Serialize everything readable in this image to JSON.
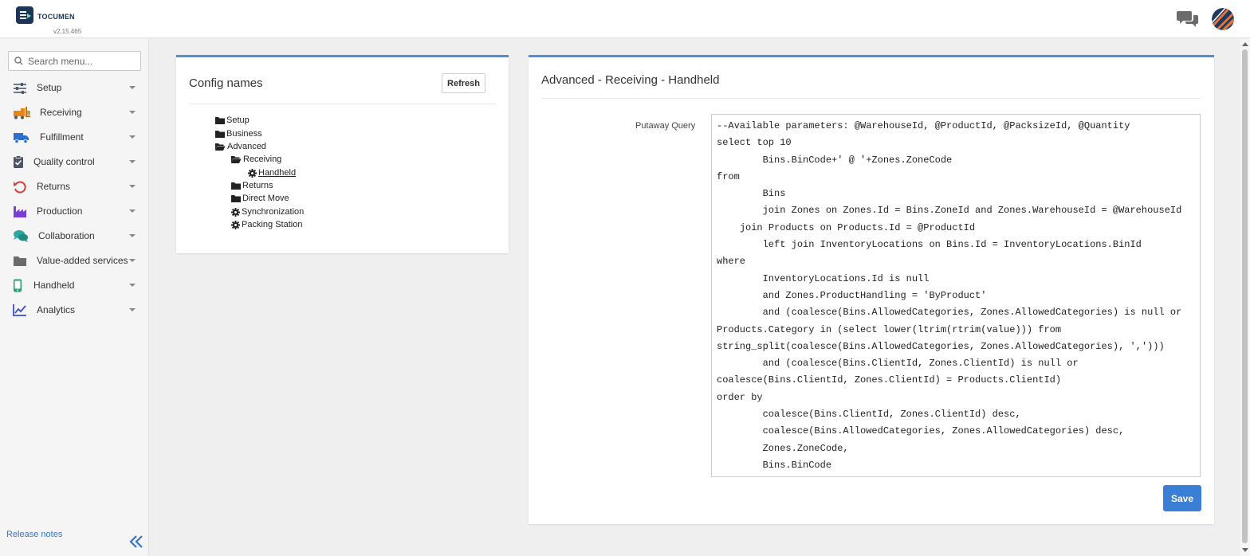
{
  "header": {
    "logo_text": "TOCUMEN",
    "version": "v2.15.465"
  },
  "sidebar": {
    "search_placeholder": "Search menu...",
    "items": [
      {
        "label": "Setup",
        "icon": "sliders-icon"
      },
      {
        "label": "Receiving",
        "icon": "forklift-icon"
      },
      {
        "label": "Fulfillment",
        "icon": "truck-icon"
      },
      {
        "label": "Quality control",
        "icon": "clipboard-check-icon"
      },
      {
        "label": "Returns",
        "icon": "undo-icon"
      },
      {
        "label": "Production",
        "icon": "factory-icon"
      },
      {
        "label": "Collaboration",
        "icon": "chat-bubbles-icon"
      },
      {
        "label": "Value-added services",
        "icon": "folder-icon"
      },
      {
        "label": "Handheld",
        "icon": "mobile-icon"
      },
      {
        "label": "Analytics",
        "icon": "chart-line-icon"
      }
    ],
    "release_notes": "Release notes"
  },
  "config_panel": {
    "title": "Config names",
    "refresh_label": "Refresh",
    "tree": [
      {
        "label": "Setup",
        "type": "folder"
      },
      {
        "label": "Business",
        "type": "folder"
      },
      {
        "label": "Advanced",
        "type": "folder-open"
      },
      {
        "label": "Receiving",
        "type": "folder-open"
      },
      {
        "label": "Handheld",
        "type": "gear",
        "active": true
      },
      {
        "label": "Returns",
        "type": "folder"
      },
      {
        "label": "Direct Move",
        "type": "folder"
      },
      {
        "label": "Synchronization",
        "type": "gear"
      },
      {
        "label": "Packing Station",
        "type": "gear"
      }
    ]
  },
  "editor_panel": {
    "title": "Advanced - Receiving - Handheld",
    "field_label": "Putaway Query",
    "query": "--Available parameters: @WarehouseId, @ProductId, @PacksizeId, @Quantity\nselect top 10\n        Bins.BinCode+' @ '+Zones.ZoneCode\nfrom\n        Bins\n        join Zones on Zones.Id = Bins.ZoneId and Zones.WarehouseId = @WarehouseId\n    join Products on Products.Id = @ProductId\n        left join InventoryLocations on Bins.Id = InventoryLocations.BinId\nwhere\n        InventoryLocations.Id is null\n        and Zones.ProductHandling = 'ByProduct'\n        and (coalesce(Bins.AllowedCategories, Zones.AllowedCategories) is null or\nProducts.Category in (select lower(ltrim(rtrim(value))) from\nstring_split(coalesce(Bins.AllowedCategories, Zones.AllowedCategories), ',')))\n        and (coalesce(Bins.ClientId, Zones.ClientId) is null or\ncoalesce(Bins.ClientId, Zones.ClientId) = Products.ClientId)\norder by\n        coalesce(Bins.ClientId, Zones.ClientId) desc,\n        coalesce(Bins.AllowedCategories, Zones.AllowedCategories) desc,\n        Zones.ZoneCode,\n        Bins.BinCode",
    "save_label": "Save"
  },
  "colors": {
    "accent": "#4a90d9",
    "save_button": "#3a7fd5",
    "link": "#3a73c8"
  }
}
